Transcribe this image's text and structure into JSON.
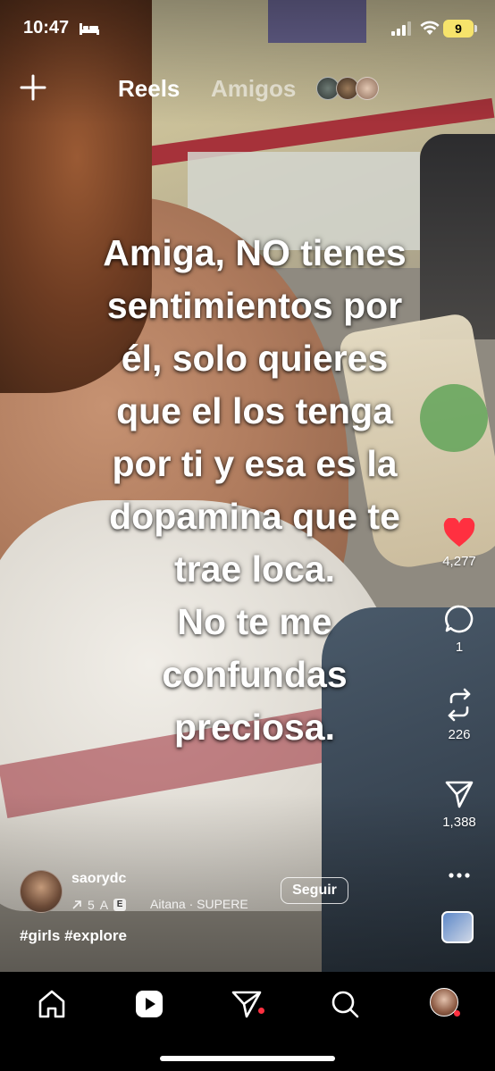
{
  "status_bar": {
    "time": "10:47",
    "battery": "9",
    "battery_color": "#f6e36b"
  },
  "top_nav": {
    "tabs": [
      {
        "label": "Reels",
        "active": true
      },
      {
        "label": "Amigos",
        "active": false
      }
    ],
    "create_icon": "plus-icon"
  },
  "caption_overlay": {
    "lines": [
      "Amiga, NO tienes",
      "sentimientos por",
      "él, solo quieres",
      "que el los tenga",
      "por ti y esa es la",
      "dopamina que te",
      "trae loca.",
      "No te me",
      "confundas",
      "preciosa."
    ]
  },
  "actions": {
    "like": {
      "icon": "heart-icon",
      "count": "4,277",
      "liked": true,
      "color": "#ff3040"
    },
    "comment": {
      "icon": "comment-icon",
      "count": "1"
    },
    "repost": {
      "icon": "repost-icon",
      "count": "226"
    },
    "share": {
      "icon": "send-icon",
      "count": "1,388"
    },
    "more": {
      "icon": "more-icon"
    }
  },
  "author": {
    "username": "saorydc",
    "reposts": "5",
    "collab_letter": "A",
    "explicit_badge": "E",
    "audio": "Aitana · SUPERE",
    "follow_label": "Seguir",
    "hashtags": "#girls #explore"
  },
  "bottom_nav": {
    "items": [
      "home-icon",
      "reels-icon",
      "messages-icon",
      "search-icon",
      "profile-avatar"
    ],
    "active": "reels-icon"
  }
}
